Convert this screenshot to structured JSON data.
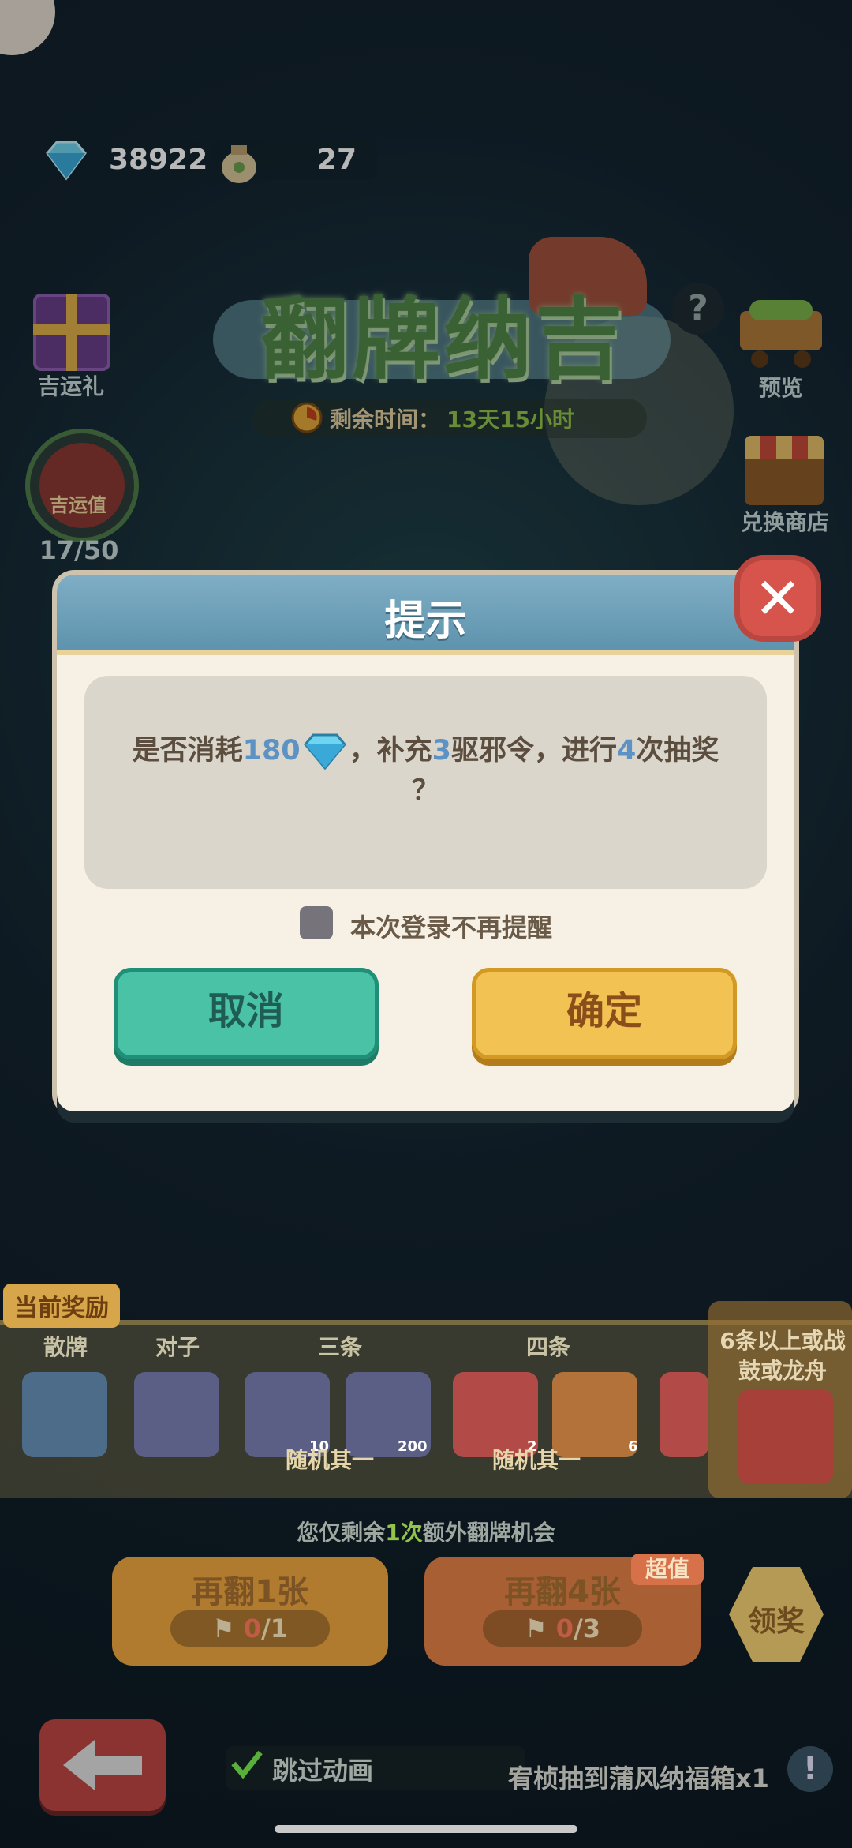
{
  "currencies": {
    "diamond_count": "38922",
    "bag_count": "27"
  },
  "side_left": {
    "gift_label": "吉运礼",
    "luck_badge_label": "吉运值",
    "luck_progress_text": "17/50",
    "luck_progress_value": 0.34
  },
  "side_right": {
    "preview_label": "预览",
    "shop_label": "兑换商店",
    "help_symbol": "?"
  },
  "event": {
    "title": "翻牌纳吉",
    "timer_label": "剩余时间：",
    "timer_value": "13天15小时"
  },
  "dialog": {
    "title": "提示",
    "message_prefix": "是否消耗",
    "diamond_cost": "180",
    "message_mid1": "，补充",
    "token_count": "3",
    "message_mid2": "驱邪令，进行",
    "draw_count": "4",
    "message_suffix": "次抽奖",
    "question_mark": "？",
    "checkbox_label": "本次登录不再提醒",
    "cancel_label": "取消",
    "confirm_label": "确定"
  },
  "rewards": {
    "tag": "当前奖励",
    "columns": [
      "散牌",
      "对子",
      "三条",
      "四条"
    ],
    "counts": [
      "10",
      "200",
      "2",
      "6"
    ],
    "random_note": "随机其一",
    "special_text": "6条以上或战鼓或龙舟"
  },
  "extra": {
    "prefix": "您仅剩余",
    "count": "1次",
    "suffix": "额外翻牌机会"
  },
  "flip_buttons": [
    {
      "label": "再翻1张",
      "cost_used": "0",
      "cost_total": "/1"
    },
    {
      "label": "再翻4张",
      "cost_used": "0",
      "cost_total": "/3"
    }
  ],
  "badge_super": "超值",
  "claim_label": "领奖",
  "bottom": {
    "skip_label": "跳过动画",
    "ticker_text": "宥桢抽到蒲风纳福箱x1",
    "info_symbol": "!"
  },
  "colors": {
    "accent_blue": "#5d92c4",
    "accent_green": "#92c44a",
    "cancel_green": "#4ac2a6",
    "confirm_yellow": "#f2c252",
    "close_red": "#d6544b"
  }
}
